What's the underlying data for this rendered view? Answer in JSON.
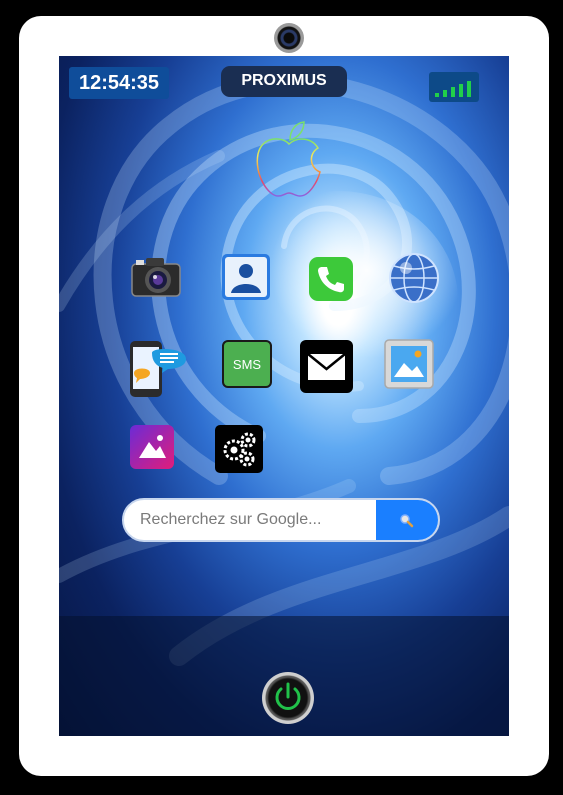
{
  "status_bar": {
    "time": "12:54:35",
    "carrier": "PROXIMUS",
    "signal_bars": 5
  },
  "apps": [
    {
      "name": "camera",
      "icon": "camera-icon"
    },
    {
      "name": "contacts",
      "icon": "contacts-icon"
    },
    {
      "name": "phone",
      "icon": "phone-icon"
    },
    {
      "name": "browser",
      "icon": "globe-icon"
    },
    {
      "name": "messenger",
      "icon": "chat-phone-icon"
    },
    {
      "name": "sms",
      "icon": "sms-icon",
      "label": "SMS"
    },
    {
      "name": "mail",
      "icon": "envelope-icon"
    },
    {
      "name": "photos",
      "icon": "picture-frame-icon"
    },
    {
      "name": "gallery",
      "icon": "gallery-icon"
    },
    {
      "name": "settings",
      "icon": "gears-icon"
    }
  ],
  "search": {
    "placeholder": "Recherchez sur Google...",
    "value": "",
    "button_icon": "magnifier-icon"
  },
  "colors": {
    "accent": "#1a7fff",
    "sms_green": "#4caf50",
    "power_green": "#21c24a"
  }
}
